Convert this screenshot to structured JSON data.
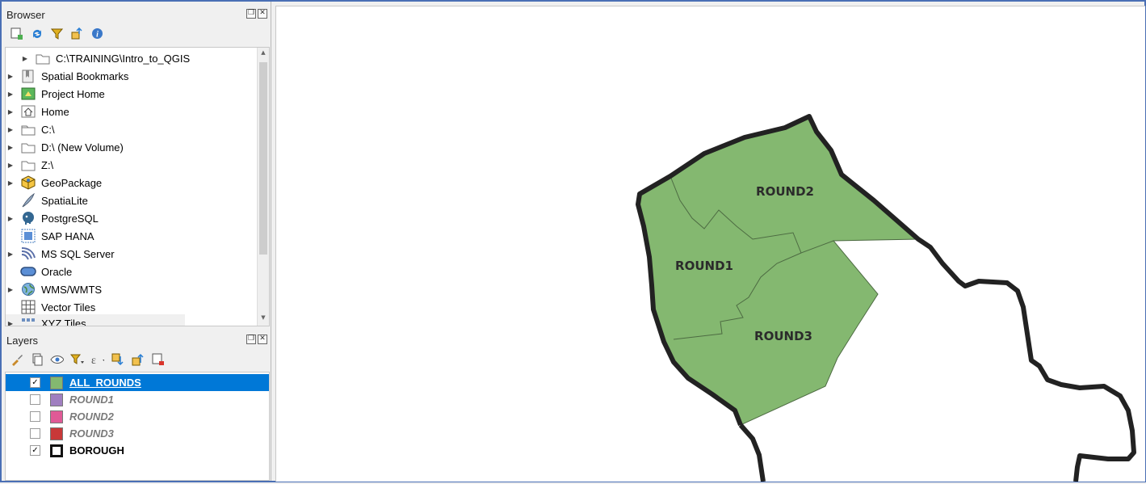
{
  "browser": {
    "title": "Browser",
    "toolbar_icons": [
      "add-layer-icon",
      "refresh-icon",
      "filter-icon",
      "collapse-icon",
      "info-icon"
    ],
    "items": [
      {
        "label": "C:\\TRAINING\\Intro_to_QGIS",
        "icon": "folder-icon",
        "expandable": true
      },
      {
        "label": "Spatial Bookmarks",
        "icon": "bookmark-icon",
        "expandable": true
      },
      {
        "label": "Project Home",
        "icon": "project-home-icon",
        "expandable": true
      },
      {
        "label": "Home",
        "icon": "home-icon",
        "expandable": true
      },
      {
        "label": "C:\\",
        "icon": "drive-icon",
        "expandable": true
      },
      {
        "label": "D:\\ (New Volume)",
        "icon": "drive-icon",
        "expandable": true
      },
      {
        "label": "Z:\\",
        "icon": "drive-icon",
        "expandable": true
      },
      {
        "label": "GeoPackage",
        "icon": "geopackage-icon",
        "expandable": true
      },
      {
        "label": "SpatiaLite",
        "icon": "spatialite-icon",
        "expandable": false
      },
      {
        "label": "PostgreSQL",
        "icon": "postgresql-icon",
        "expandable": true
      },
      {
        "label": "SAP HANA",
        "icon": "sap-hana-icon",
        "expandable": false
      },
      {
        "label": "MS SQL Server",
        "icon": "mssql-icon",
        "expandable": true
      },
      {
        "label": "Oracle",
        "icon": "oracle-icon",
        "expandable": false
      },
      {
        "label": "WMS/WMTS",
        "icon": "globe-icon",
        "expandable": true
      },
      {
        "label": "Vector Tiles",
        "icon": "grid-icon",
        "expandable": false
      },
      {
        "label": "XYZ Tiles",
        "icon": "grid-icon",
        "expandable": true
      }
    ]
  },
  "layers": {
    "title": "Layers",
    "items": [
      {
        "label": "ALL_ROUNDS",
        "checked": true,
        "color": "#84b870",
        "selected": true
      },
      {
        "label": "ROUND1",
        "checked": false,
        "color": "#a07fc0",
        "selected": false
      },
      {
        "label": "ROUND2",
        "checked": false,
        "color": "#e05a96",
        "selected": false
      },
      {
        "label": "ROUND3",
        "checked": false,
        "color": "#c83838",
        "selected": false
      },
      {
        "label": "BOROUGH",
        "checked": true,
        "color": "#ffffff",
        "selected": false
      }
    ]
  },
  "map": {
    "fill_color": "#84b870",
    "labels": {
      "round1": "ROUND1",
      "round2": "ROUND2",
      "round3": "ROUND3"
    }
  }
}
